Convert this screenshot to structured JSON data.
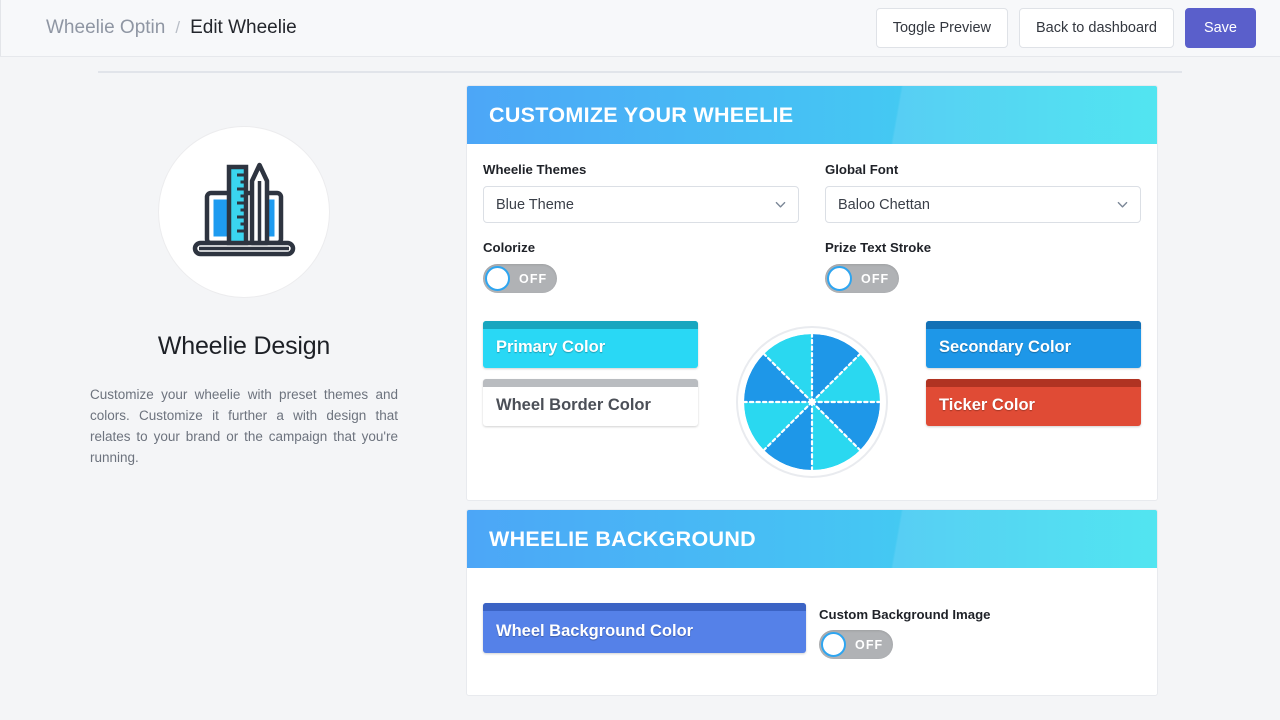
{
  "topbar": {
    "breadcrumb_root": "Wheelie Optin",
    "breadcrumb_separator": "/",
    "breadcrumb_current": "Edit Wheelie",
    "toggle_preview_label": "Toggle Preview",
    "back_label": "Back to dashboard",
    "save_label": "Save",
    "save_color": "#5a5fcb"
  },
  "left_panel": {
    "icon": "laptop-ruler-pencil-icon",
    "title": "Wheelie Design",
    "description": "Customize your wheelie with preset themes and colors. Customize it further a with design that relates to your brand or the campaign that you're running."
  },
  "customize_card": {
    "header": "CUSTOMIZE YOUR WHEELIE",
    "header_gradient_from": "#4ca6f7",
    "header_gradient_to": "#3ee2ef",
    "themes_label": "Wheelie Themes",
    "themes_value": "Blue Theme",
    "font_label": "Global Font",
    "font_value": "Baloo Chettan",
    "colorize_label": "Colorize",
    "colorize_state": "OFF",
    "prize_stroke_label": "Prize Text Stroke",
    "prize_stroke_state": "OFF",
    "colors": [
      {
        "name": "primary",
        "label": "Primary Color",
        "fill": "#29d8f5",
        "top": "#18a6bf",
        "text": "light"
      },
      {
        "name": "wheel-border",
        "label": "Wheel Border Color",
        "fill": "#ffffff",
        "top": "#b9bcc0",
        "text": "dark"
      },
      {
        "name": "secondary",
        "label": "Secondary Color",
        "fill": "#1e97e8",
        "top": "#1270b5",
        "text": "light"
      },
      {
        "name": "ticker",
        "label": "Ticker Color",
        "fill": "#e04b35",
        "top": "#b03322",
        "text": "light"
      }
    ],
    "wheel_preview": {
      "segments": 8,
      "segment_colors": [
        "#2ad8f0",
        "#1e97e8"
      ],
      "separator_color": "#ffffff",
      "ring_color": "#e9ebef"
    }
  },
  "background_card": {
    "header": "WHEELIE BACKGROUND",
    "bg_color_label": "Wheel Background Color",
    "bg_color_fill": "#5581e8",
    "bg_color_top": "#3b63c4",
    "custom_image_label": "Custom Background Image",
    "custom_image_state": "OFF"
  }
}
